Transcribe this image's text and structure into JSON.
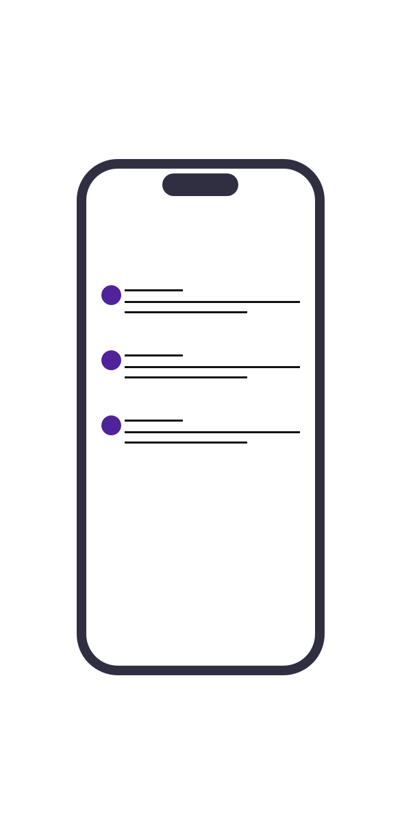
{
  "colors": {
    "device_frame": "#302f42",
    "avatar": "#4f249a",
    "placeholder_line": "#111111",
    "screen_background": "#ffffff"
  },
  "list": {
    "items": [
      {
        "avatar_icon": "avatar-placeholder"
      },
      {
        "avatar_icon": "avatar-placeholder"
      },
      {
        "avatar_icon": "avatar-placeholder"
      }
    ]
  }
}
